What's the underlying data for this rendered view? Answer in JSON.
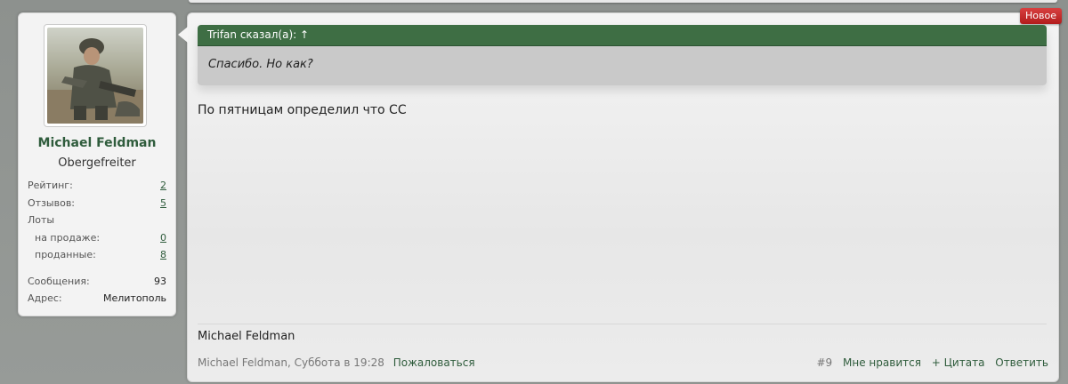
{
  "post": {
    "new_badge": "Новое",
    "quote": {
      "header": "Trifan сказал(а):",
      "arrow": "↑",
      "text": "Спасибо. Но как?"
    },
    "message": "По пятницам определил что СС",
    "signature": "Michael Feldman",
    "footer": {
      "author_date": "Michael Feldman, Суббота в 19:28",
      "report": "Пожаловаться",
      "post_number": "#9",
      "like": "Мне нравится",
      "quote": "+ Цитата",
      "reply": "Ответить"
    }
  },
  "user": {
    "name": "Michael Feldman",
    "title": "Obergefreiter",
    "stats": {
      "rating_label": "Рейтинг:",
      "rating": "2",
      "reviews_label": "Отзывов:",
      "reviews": "5",
      "lots_label": "Лоты",
      "on_sale_label": "на продаже:",
      "on_sale": "0",
      "sold_label": "проданные:",
      "sold": "8",
      "messages_label": "Сообщения:",
      "messages": "93",
      "address_label": "Адрес:",
      "address": "Мелитополь"
    }
  },
  "colors": {
    "accent_green": "#3e6e44",
    "link_green": "#2f5c3c",
    "badge_red": "#c22a2a"
  }
}
